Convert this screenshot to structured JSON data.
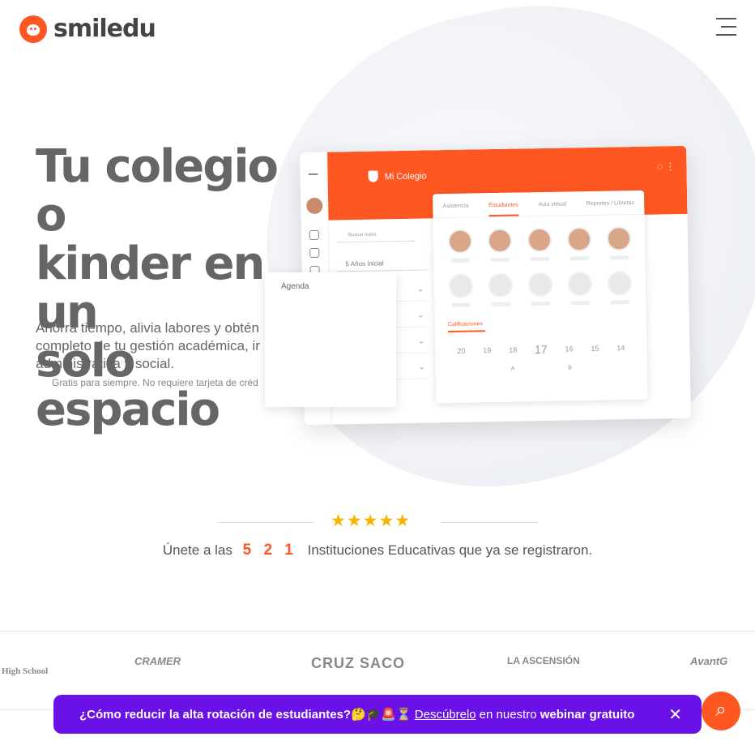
{
  "brand": {
    "name": "smiledu"
  },
  "hero": {
    "title": "Tu colegio o\nkinder en un\nsolo espacio",
    "text": "Ahorra tiempo, alivia labores y obtén completo de tu gestión académica, ir administrativa y social.",
    "note": "Gratis para siempre. No requiere tarjeta de créd"
  },
  "app": {
    "title": "Mi Colegio",
    "search_placeholder": "Buscar aulas",
    "select_value": "5 Años Inicial",
    "tabs": [
      "Asistencia",
      "Estudiantes",
      "Aula virtual",
      "Reportes / Libretas"
    ],
    "active_tab": "Estudiantes",
    "section": "Calificaciones",
    "grades": [
      "20",
      "19",
      "18",
      "17",
      "16",
      "15",
      "14"
    ],
    "grade_labels": [
      "A",
      "B"
    ],
    "agenda": "Agenda"
  },
  "stats": {
    "prefix": "Únete a las",
    "count": "5 2 1",
    "suffix": "Instituciones Educativas que ya se registraron."
  },
  "schools": [
    "High School",
    "CRAMER",
    "CRUZ SACO",
    "LA ASCENSIÓN",
    "AvantG"
  ],
  "banner": {
    "lead": "¿Cómo reducir la alta rotación de estudiantes?🤔🎓🚨⏳",
    "link": "Descúbrelo",
    "mid": "en nuestro",
    "end": "webinar gratuito",
    "close": "✕"
  }
}
